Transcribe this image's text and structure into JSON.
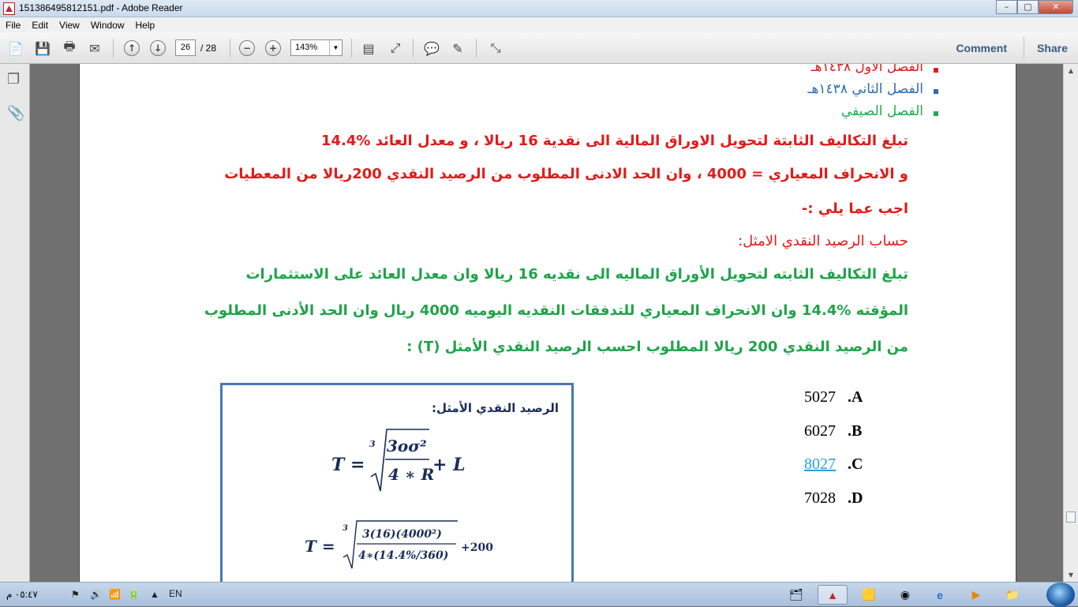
{
  "window": {
    "title": "151386495812151.pdf - Adobe Reader",
    "buttons": [
      "minimize",
      "maximize",
      "close"
    ]
  },
  "menu": [
    "File",
    "Edit",
    "View",
    "Window",
    "Help"
  ],
  "toolbar": {
    "page_current": "26",
    "page_total": "/ 28",
    "zoom": "143%",
    "comment_label": "Comment",
    "share_label": "Share"
  },
  "document": {
    "bullets": [
      {
        "text": "الفصل الأول ١٤٣٨هـ",
        "color": "#e11b1b"
      },
      {
        "text": "الفصل الثاني ١٤٣٨هـ",
        "color": "#2b6cb0"
      },
      {
        "text": "الفصل الصيفي",
        "color": "#22a84f"
      }
    ],
    "red_lines": [
      "تبلغ التكاليف الثابتة لتحويل الاوراق المالية الى نقدية 16 ريالا ، و معدل العائد %14.4",
      "و الانحراف المعياري = 4000 ، وان الحد الادنى المطلوب من الرصيد النقدي 200ريالا من المعطيات",
      "اجب عما يلي :-",
      "حساب الرصيد النقدي الامثل:"
    ],
    "green_lines": [
      "تبلغ التكاليف الثابته لتحويل الأوراق الماليه الى نقديه 16 ريالا وان معدل العائد على الاستثمارات",
      "المؤقته %14.4 وان الانحراف المعياري للتدفقات النقديه اليوميه 4000 ريال وان الحد الأدنى المطلوب",
      "من الرصيد النقدي 200 ريالا المطلوب احسب الرصيد النقدي الأمثل  (T) :"
    ],
    "answers": [
      {
        "letter": ".A",
        "value": "5027",
        "selected": false
      },
      {
        "letter": ".B",
        "value": "6027",
        "selected": false
      },
      {
        "letter": ".C",
        "value": "8027",
        "selected": true
      },
      {
        "letter": ".D",
        "value": "7028",
        "selected": false
      }
    ],
    "formula_box": {
      "title": "الرصيد النقدي الأمثل:",
      "f1_lhs": "T =",
      "f1_num": "3oσ²",
      "f1_den": "4 ∗ R",
      "f1_tail": "+ L",
      "f2_lhs": "T =",
      "f2_num": "3(16)(4000²)",
      "f2_den": "4∗(14.4%/360)",
      "f2_tail": "+200",
      "root_index": "3"
    }
  },
  "taskbar": {
    "clock": "٠٥:٤٧ م",
    "language": "EN"
  }
}
